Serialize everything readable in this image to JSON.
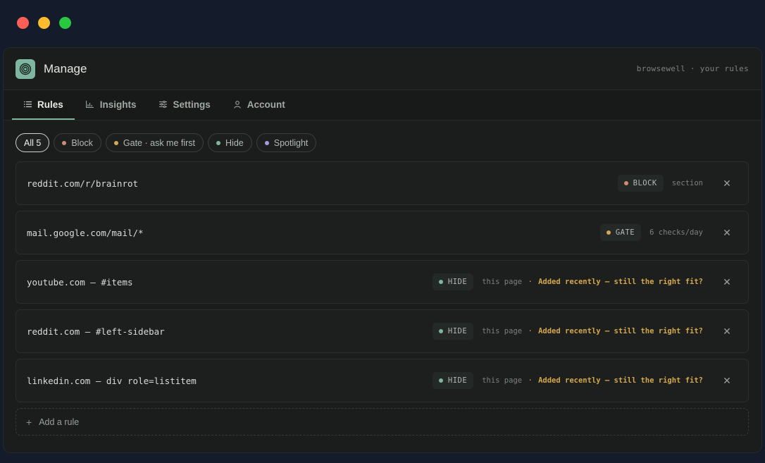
{
  "app": {
    "title": "Manage",
    "tagline": "browsewell · your rules",
    "accent": "#7fb6a0"
  },
  "tabs": [
    {
      "label": "Rules",
      "icon": "list-icon",
      "active": true
    },
    {
      "label": "Insights",
      "icon": "bar-chart-icon",
      "active": false
    },
    {
      "label": "Settings",
      "icon": "sliders-icon",
      "active": false
    },
    {
      "label": "Account",
      "icon": "user-icon",
      "active": false
    }
  ],
  "filters": [
    {
      "label": "All 5",
      "active": true
    },
    {
      "label": "Block",
      "color": "#d08a76"
    },
    {
      "label": "Gate · ask me first",
      "color": "#d2a957"
    },
    {
      "label": "Hide",
      "color": "#7fb6a0"
    },
    {
      "label": "Spotlight",
      "color": "#a79be0"
    }
  ],
  "rules": [
    {
      "target": "reddit.com/r/brainrot",
      "type": "BLOCK",
      "type_color": "#d08a76",
      "scope": "section",
      "note": ""
    },
    {
      "target": "mail.google.com/mail/*",
      "type": "GATE",
      "type_color": "#d2a957",
      "scope": "6 checks/day",
      "note": ""
    },
    {
      "target": "youtube.com — #items",
      "type": "HIDE",
      "type_color": "#7fb6a0",
      "scope": "this page",
      "note": "Added recently — still the right fit?"
    },
    {
      "target": "reddit.com — #left-sidebar",
      "type": "HIDE",
      "type_color": "#7fb6a0",
      "scope": "this page",
      "note": "Added recently — still the right fit?"
    },
    {
      "target": "linkedin.com — div role=listitem",
      "type": "HIDE",
      "type_color": "#7fb6a0",
      "scope": "this page",
      "note": "Added recently — still the right fit?"
    }
  ],
  "add_rule": {
    "label": "Add a rule",
    "icon": "plus-icon"
  },
  "separator": "·"
}
